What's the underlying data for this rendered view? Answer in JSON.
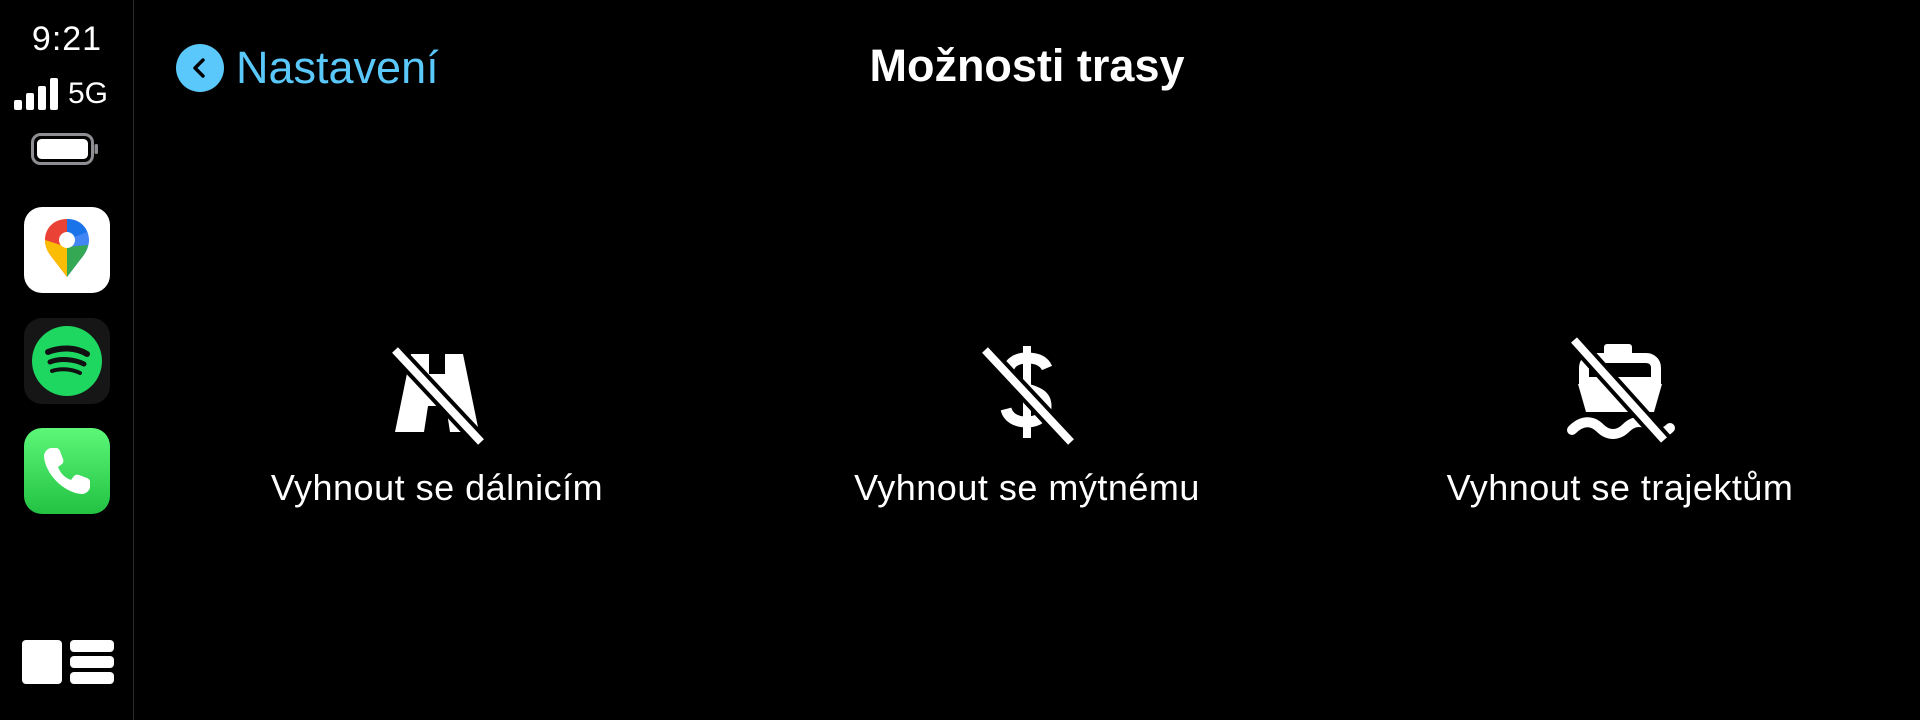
{
  "status": {
    "time": "9:21",
    "network": "5G",
    "signal_bars_filled": 4
  },
  "sidebar": {
    "apps": [
      {
        "name": "Google Maps",
        "icon": "google-maps-icon"
      },
      {
        "name": "Spotify",
        "icon": "spotify-icon",
        "color": "#1ed760"
      },
      {
        "name": "Phone",
        "icon": "phone-icon",
        "color": "#2fd24f"
      }
    ],
    "dashboard_icon": "dashboard-icon"
  },
  "header": {
    "back_label": "Nastavení",
    "title": "Možnosti trasy"
  },
  "options": [
    {
      "label": "Vyhnout se dálnicím",
      "icon": "no-highway-icon"
    },
    {
      "label": "Vyhnout se mýtnému",
      "icon": "no-toll-icon"
    },
    {
      "label": "Vyhnout se trajektům",
      "icon": "no-ferry-icon"
    }
  ],
  "colors": {
    "accent": "#5ac8fa",
    "background": "#000000",
    "text": "#ffffff"
  }
}
